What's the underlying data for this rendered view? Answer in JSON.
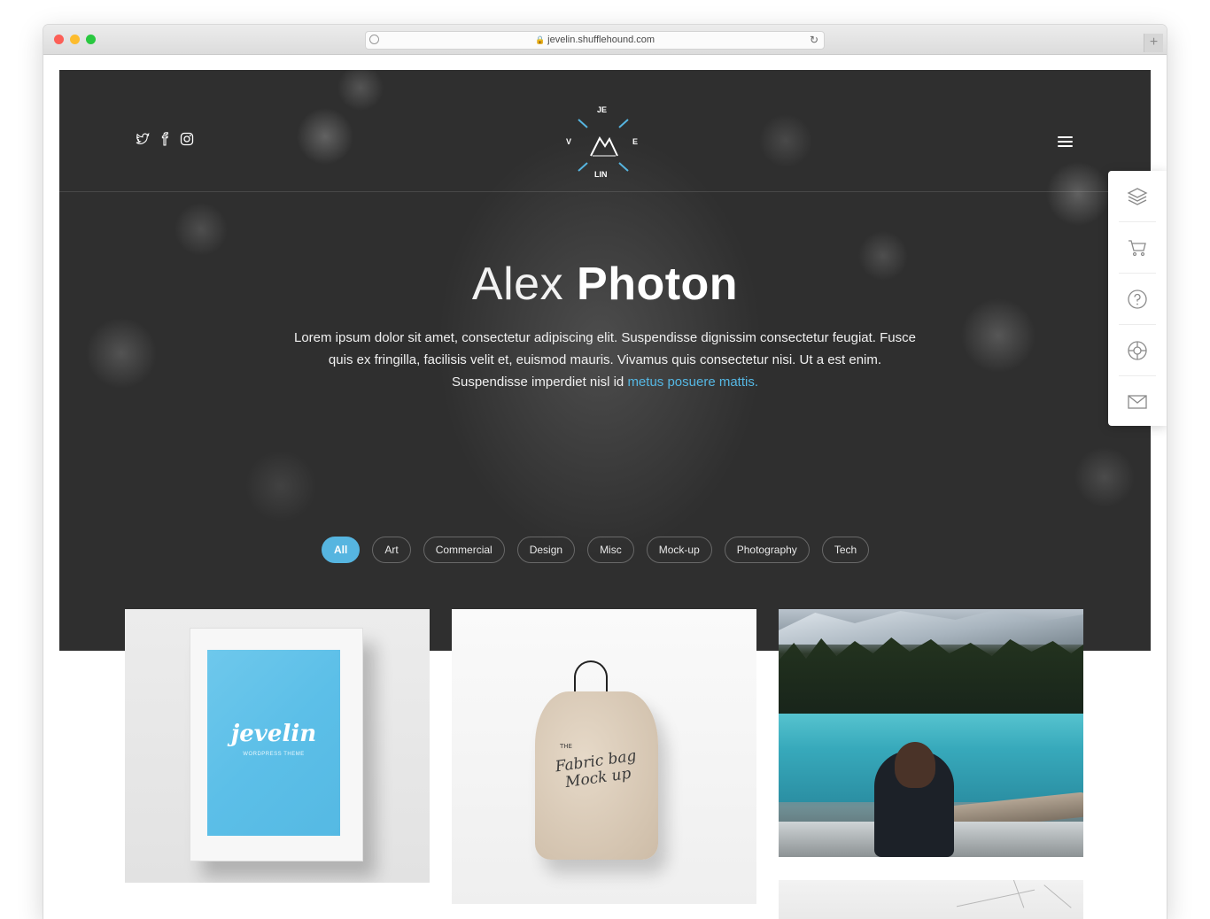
{
  "browser": {
    "url": "jevelin.shufflehound.com",
    "new_tab_label": "+"
  },
  "header": {
    "social_icons": [
      "twitter-icon",
      "facebook-icon",
      "instagram-icon"
    ],
    "logo": {
      "top": "JE",
      "left": "V",
      "right": "E",
      "bottom": "LIN",
      "accent_color": "#56b5e0"
    },
    "menu_icon": "hamburger-menu-icon"
  },
  "hero": {
    "title_light": "Alex",
    "title_bold": "Photon",
    "description": "Lorem ipsum dolor sit amet, consectetur adipiscing elit. Suspendisse dignissim consectetur feugiat. Fusce quis ex fringilla, facilisis velit et, euismod mauris. Vivamus quis consectetur nisi. Ut a est enim. Suspendisse imperdiet nisl id",
    "description_link": "metus posuere mattis.",
    "link_color": "#55b7e3"
  },
  "filters": {
    "items": [
      {
        "label": "All",
        "active": true
      },
      {
        "label": "Art",
        "active": false
      },
      {
        "label": "Commercial",
        "active": false
      },
      {
        "label": "Design",
        "active": false
      },
      {
        "label": "Misc",
        "active": false
      },
      {
        "label": "Mock-up",
        "active": false
      },
      {
        "label": "Photography",
        "active": false
      },
      {
        "label": "Tech",
        "active": false
      }
    ],
    "active_color": "#56b5e0"
  },
  "side_panel": {
    "icons": [
      "layers-icon",
      "cart-icon",
      "help-icon",
      "support-icon",
      "mail-icon"
    ]
  },
  "portfolio": {
    "frame_brand": "jevelin",
    "frame_subtitle": "WORDPRESS THEME",
    "bag_small": "THE",
    "bag_text": "Fabric bag Mock up"
  }
}
